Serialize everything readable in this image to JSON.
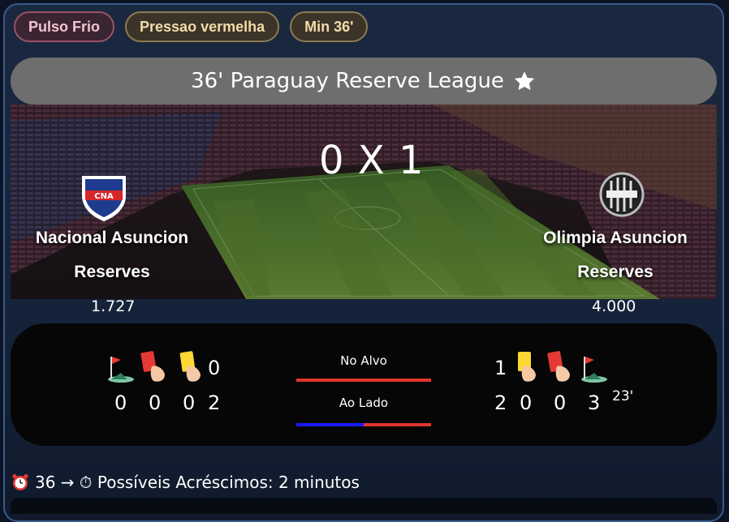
{
  "tags": [
    {
      "label": "Pulso Frio"
    },
    {
      "label": "Pressao vermelha"
    },
    {
      "label": "Min 36'"
    }
  ],
  "league": {
    "title": "36' Paraguay Reserve League"
  },
  "match": {
    "score": "0 X 1",
    "home": {
      "name_line1": "Nacional Asuncion",
      "name_line2": "Reserves",
      "odd": "1.727"
    },
    "away": {
      "name_line1": "Olimpia Asuncion",
      "name_line2": "Reserves",
      "odd": "4.000"
    }
  },
  "stats": {
    "home": {
      "yellow": "0",
      "corners": "0",
      "reds": "0",
      "yellows_total": "0",
      "shots": "2"
    },
    "away": {
      "yellow": "1",
      "shots": "2",
      "reds": "0",
      "yellows_total": "0",
      "corners": "3",
      "last_event": "23'"
    },
    "on_target_label": "No Alvo",
    "off_target_label": "Ao Lado",
    "on_target_home_fraction": 0.0,
    "off_target_home_fraction": 0.5,
    "colors": {
      "home_bar": "#1a1aff",
      "away_bar": "#e0362c"
    }
  },
  "footer": {
    "text": "36 → ⏱ Possíveis Acréscimos: 2 minutos"
  }
}
